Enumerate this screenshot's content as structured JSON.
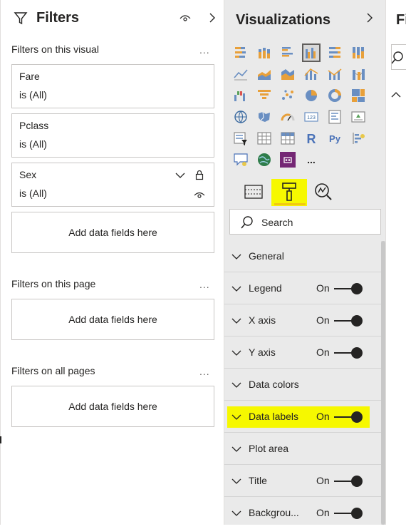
{
  "filters": {
    "title": "Filters",
    "visual_section": "Filters on this visual",
    "more": "...",
    "cards": [
      {
        "name": "Fare",
        "value": "is (All)"
      },
      {
        "name": "Pclass",
        "value": "is (All)"
      },
      {
        "name": "Sex",
        "value": "is (All)"
      }
    ],
    "add_label": "Add data fields here",
    "page_section": "Filters on this page",
    "all_section": "Filters on all pages"
  },
  "visualizations": {
    "title": "Visualizations",
    "search_placeholder": "Search",
    "ellipsis": "...",
    "rows": [
      {
        "label": "General",
        "on": ""
      },
      {
        "label": "Legend",
        "on": "On"
      },
      {
        "label": "X axis",
        "on": "On"
      },
      {
        "label": "Y axis",
        "on": "On"
      },
      {
        "label": "Data colors",
        "on": ""
      },
      {
        "label": "Data labels",
        "on": "On"
      },
      {
        "label": "Plot area",
        "on": ""
      },
      {
        "label": "Title",
        "on": "On"
      },
      {
        "label": "Backgrou...",
        "on": "On"
      }
    ],
    "highlight_color": "#f6f800",
    "accent_color": "#f2c811"
  },
  "fields_pane": {
    "title": "Fi"
  }
}
